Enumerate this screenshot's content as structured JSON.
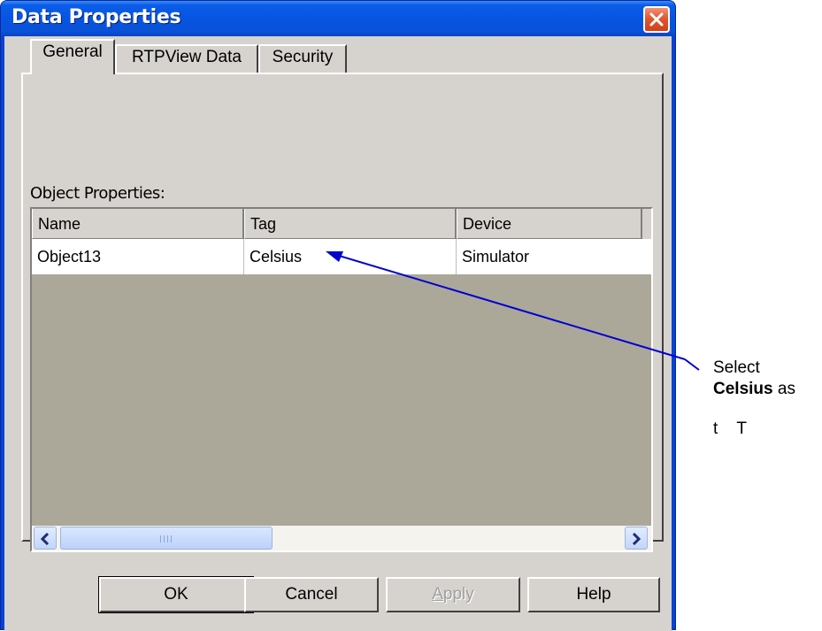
{
  "window": {
    "title": "Data Properties"
  },
  "tabs": [
    {
      "label": "General",
      "active": true
    },
    {
      "label": "RTPView Data",
      "active": false
    },
    {
      "label": "Security",
      "active": false
    }
  ],
  "object_properties": {
    "label": "Object Properties:",
    "columns": [
      "Name",
      "Tag",
      "Device"
    ],
    "rows": [
      {
        "name": "Object13",
        "tag": "Celsius",
        "device": "Simulator"
      }
    ]
  },
  "buttons": {
    "ok": "OK",
    "cancel": "Cancel",
    "apply_prefix": "A",
    "apply_rest": "pply",
    "help": "Help"
  },
  "annotation": {
    "line1": "Select",
    "line2_bold": "Celsius",
    "line2_rest": " as"
  },
  "colors": {
    "titlebar": "#0654e0",
    "dialog_face": "#d6d3ce",
    "list_empty_bg": "#aca899",
    "arrow": "#0000d0",
    "close_button": "#e2572f"
  },
  "icons": {
    "close": "close-x-icon",
    "scroll_left": "arrow-left-icon",
    "scroll_right": "arrow-right-icon"
  }
}
